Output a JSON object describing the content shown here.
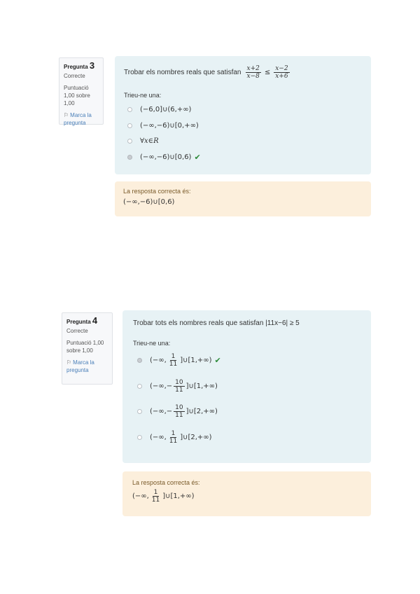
{
  "q3": {
    "label": "Pregunta",
    "number": "3",
    "state": "Correcte",
    "grade": "Puntuació 1,00 sobre 1,00",
    "flag_label": "Marca la pregunta",
    "text_prefix": "Trobar els nombres reals que satisfan",
    "frac_left": {
      "num": "x+2",
      "den": "x−8"
    },
    "relation": "≤",
    "frac_right": {
      "num": "x−2",
      "den": "x+6"
    },
    "prompt": "Trieu-ne una:",
    "options": [
      {
        "text": "(−6,0]∪(6,+∞)",
        "selected": false,
        "correct_mark": false
      },
      {
        "text": "(−∞,−6)∪[0,+∞)",
        "selected": false,
        "correct_mark": false
      },
      {
        "text": "∀x∈R",
        "selected": false,
        "correct_mark": false
      },
      {
        "text": "(−∞,−6)∪[0,6)",
        "selected": true,
        "correct_mark": true
      }
    ],
    "feedback_label": "La resposta correcta és:",
    "feedback_answer": "(−∞,−6)∪[0,6)"
  },
  "q4": {
    "label": "Pregunta",
    "number": "4",
    "state": "Correcte",
    "grade": "Puntuació 1,00 sobre 1,00",
    "flag_label": "Marca la pregunta",
    "text": "Trobar tots els nombres reals que satisfan |11x−6| ≥ 5",
    "prompt": "Trieu-ne una:",
    "options": [
      {
        "pre": "(−∞,",
        "num": "1",
        "den": "11",
        "post": "]∪[1,+∞)",
        "selected": true,
        "correct_mark": true
      },
      {
        "pre": "(−∞,−",
        "num": "10",
        "den": "11",
        "post": "]∪[1,+∞)",
        "selected": false,
        "correct_mark": false
      },
      {
        "pre": "(−∞,−",
        "num": "10",
        "den": "11",
        "post": "]∪[2,+∞)",
        "selected": false,
        "correct_mark": false
      },
      {
        "pre": "(−∞,",
        "num": "1",
        "den": "11",
        "post": "]∪[2,+∞)",
        "selected": false,
        "correct_mark": false
      }
    ],
    "feedback_label": "La resposta correcta és:",
    "feedback_answer": {
      "pre": "(−∞,",
      "num": "1",
      "den": "11",
      "post": "]∪[1,+∞)"
    }
  }
}
